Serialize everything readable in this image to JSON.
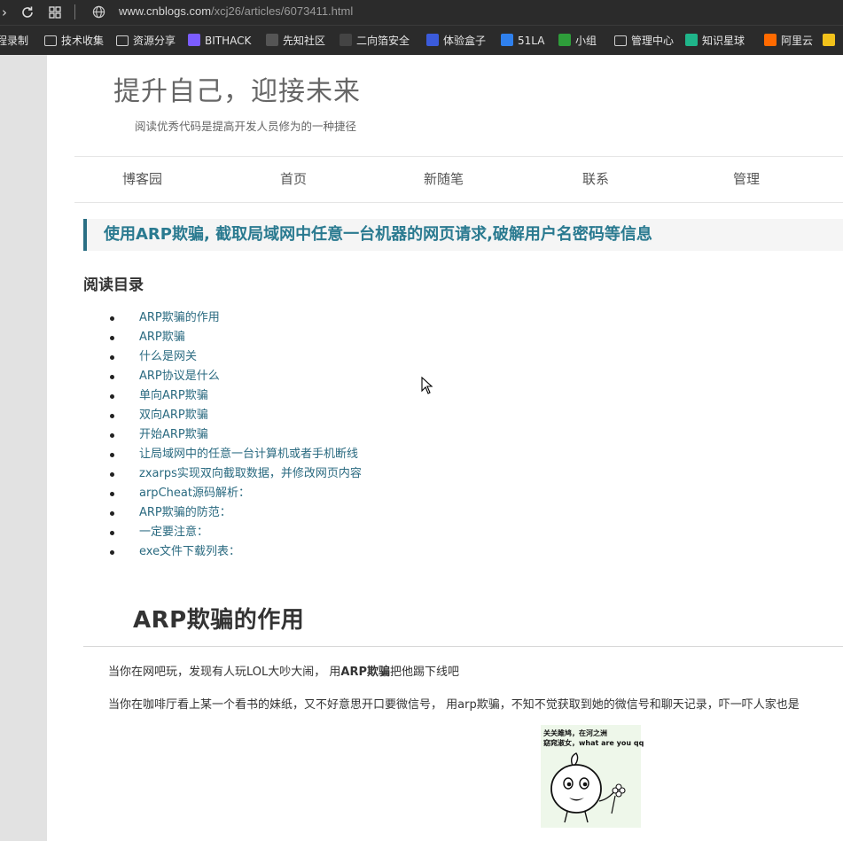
{
  "browser": {
    "url_host": "www.cnblogs.com",
    "url_path": "/xcj26/articles/6073411.html",
    "bookmarks": [
      {
        "label": "程录制",
        "color": "#2b2b2b"
      },
      {
        "label": "技术收集",
        "color": "#cfcfcf"
      },
      {
        "label": "资源分享",
        "color": "#cfcfcf"
      },
      {
        "label": "BITHACK",
        "color": "#7b5cff"
      },
      {
        "label": "先知社区",
        "color": "#555555"
      },
      {
        "label": "二向箔安全",
        "color": "#444444"
      },
      {
        "label": "体验盒子",
        "color": "#3b5bdb"
      },
      {
        "label": "51LA",
        "color": "#2f80ed"
      },
      {
        "label": "小组",
        "color": "#2e9d3a"
      },
      {
        "label": "管理中心",
        "color": "#cfcfcf"
      },
      {
        "label": "知识星球",
        "color": "#1fb58a"
      },
      {
        "label": "阿里云",
        "color": "#ff6a00"
      },
      {
        "label": "",
        "color": "#f2c21b"
      }
    ]
  },
  "blog": {
    "title": "提升自己，迎接未来",
    "subtitle": "阅读优秀代码是提高开发人员修为的一种捷径",
    "nav": [
      "博客园",
      "首页",
      "新随笔",
      "联系",
      "管理"
    ]
  },
  "post": {
    "title": "使用ARP欺骗, 截取局域网中任意一台机器的网页请求,破解用户名密码等信息",
    "toc_heading": "阅读目录",
    "toc": [
      "ARP欺骗的作用",
      "ARP欺骗",
      "什么是网关",
      "ARP协议是什么",
      "单向ARP欺骗",
      "双向ARP欺骗",
      "开始ARP欺骗",
      "让局域网中的任意一台计算机或者手机断线",
      "zxarps实现双向截取数据，并修改网页内容",
      "arpCheat源码解析：",
      "ARP欺骗的防范：",
      "一定要注意：",
      "exe文件下载列表："
    ],
    "section_heading": "ARP欺骗的作用",
    "para1_a": "当你在网吧玩，发现有人玩LOL大吵大闹， 用",
    "para1_b": "ARP欺骗",
    "para1_c": "把他踢下线吧",
    "para2": "当你在咖啡厅看上某一个看书的妹纸，又不好意思开口要微信号， 用arp欺骗，不知不觉获取到她的微信号和聊天记录，吓一吓人家也是",
    "meme_line1": "关关雎鸠，在河之洲",
    "meme_line2": "窈窕淑女，what are you qq"
  }
}
